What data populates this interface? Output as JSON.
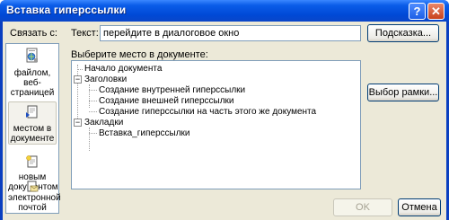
{
  "window": {
    "title": "Вставка гиперссылки",
    "help_glyph": "?",
    "close_glyph": "✕"
  },
  "sidebar": {
    "label": "Связать с:",
    "items": [
      {
        "label": "файлом, веб-страницей",
        "icon": "web-page-icon",
        "selected": false
      },
      {
        "label": "местом в документе",
        "icon": "document-place-icon",
        "selected": true
      },
      {
        "label": "новым документом",
        "icon": "new-document-icon",
        "selected": false
      },
      {
        "label": "электронной почтой",
        "icon": "email-icon",
        "selected": false
      }
    ]
  },
  "text_field": {
    "label": "Текст:",
    "value": "перейдите в диалоговое окно"
  },
  "buttons": {
    "hint": "Подсказка...",
    "frame": "Выбор рамки...",
    "ok": "OK",
    "cancel": "Отмена"
  },
  "place": {
    "label": "Выберите место в документе:",
    "tree": [
      {
        "label": "Начало документа",
        "level": 1,
        "expander": ""
      },
      {
        "label": "Заголовки",
        "level": 1,
        "expander": "−"
      },
      {
        "label": "Создание внутренней гиперссылки",
        "level": 2,
        "expander": ""
      },
      {
        "label": "Создание внешней гиперссылки",
        "level": 2,
        "expander": ""
      },
      {
        "label": "Создание гиперссылки на часть этого же документа",
        "level": 2,
        "expander": ""
      },
      {
        "label": "Закладки",
        "level": 1,
        "expander": "−"
      },
      {
        "label": "Вставка_гиперссылки",
        "level": 2,
        "expander": ""
      }
    ]
  },
  "colors": {
    "title_bar": "#0054e3",
    "dialog_bg": "#ece9d8",
    "field_border": "#7f9db9"
  }
}
